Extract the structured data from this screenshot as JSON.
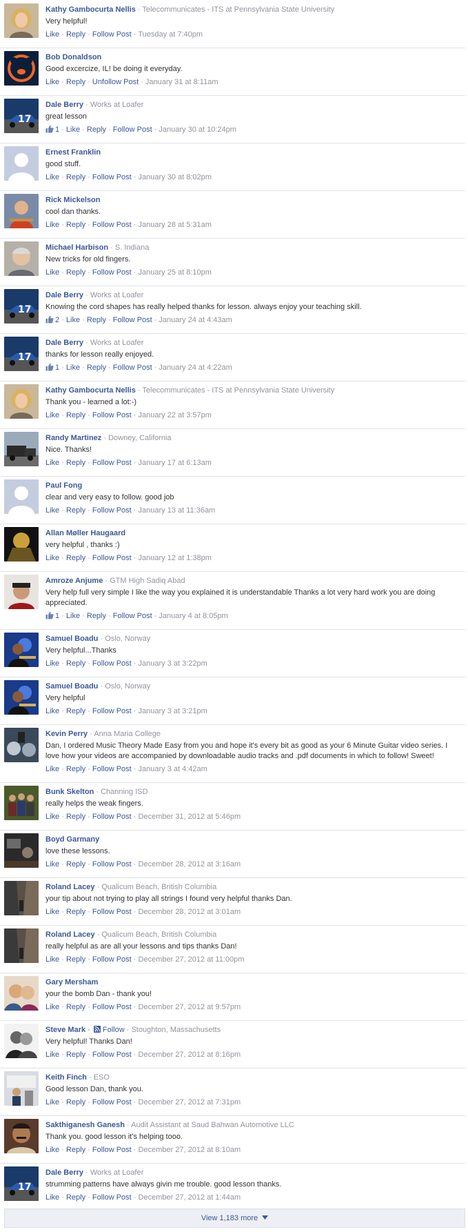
{
  "labels": {
    "like": "Like",
    "reply": "Reply",
    "follow_post": "Follow Post",
    "unfollow_post": "Unfollow Post",
    "follow": "Follow",
    "dot": " · "
  },
  "comments": [
    {
      "author": "Kathy Gambocurta Nellis",
      "subtitle": "Telecommunicates - ITS at Pennsylvania State University",
      "text": "Very helpful!",
      "likes": "",
      "follow": "Follow Post",
      "time": "Tuesday at 7:40pm",
      "avatar": "woman-blonde"
    },
    {
      "author": "Bob Donaldson",
      "subtitle": "",
      "text": "Good excercize, IL! be doing it everyday.",
      "likes": "",
      "follow": "Unfollow Post",
      "time": "January 31 at 8:11am",
      "avatar": "bears-logo"
    },
    {
      "author": "Dale Berry",
      "subtitle": "Works at Loafer",
      "text": "great lesson",
      "likes": "1",
      "follow": "Follow Post",
      "time": "January 30 at 10:24pm",
      "avatar": "race-car"
    },
    {
      "author": "Ernest Franklin",
      "subtitle": "",
      "text": "good stuff.",
      "likes": "",
      "follow": "Follow Post",
      "time": "January 30 at 8:02pm",
      "avatar": "default"
    },
    {
      "author": "Rick Mickelson",
      "subtitle": "",
      "text": "cool dan thanks.",
      "likes": "",
      "follow": "Follow Post",
      "time": "January 28 at 5:31am",
      "avatar": "man-guitar"
    },
    {
      "author": "Michael Harbison",
      "subtitle": "S. Indiana",
      "text": "New tricks for old fingers.",
      "likes": "",
      "follow": "Follow Post",
      "time": "January 25 at 8:10pm",
      "avatar": "man-gray"
    },
    {
      "author": "Dale Berry",
      "subtitle": "Works at Loafer",
      "text": "Knowing the cord shapes has really helped thanks for lesson. always enjoy your teaching skill.",
      "likes": "2",
      "follow": "Follow Post",
      "time": "January 24 at 4:43am",
      "avatar": "race-car"
    },
    {
      "author": "Dale Berry",
      "subtitle": "Works at Loafer",
      "text": "thanks for lesson really enjoyed.",
      "likes": "1",
      "follow": "Follow Post",
      "time": "January 24 at 4:22am",
      "avatar": "race-car"
    },
    {
      "author": "Kathy Gambocurta Nellis",
      "subtitle": "Telecommunicates - ITS at Pennsylvania State University",
      "text": "Thank you - learned a lot:-)",
      "likes": "",
      "follow": "Follow Post",
      "time": "January 22 at 3:57pm",
      "avatar": "woman-blonde"
    },
    {
      "author": "Randy Martinez",
      "subtitle": "Downey, California",
      "text": "Nice. Thanks!",
      "likes": "",
      "follow": "Follow Post",
      "time": "January 17 at 6:13am",
      "avatar": "truck"
    },
    {
      "author": "Paul Fong",
      "subtitle": "",
      "text": "clear and very easy to follow. good job",
      "likes": "",
      "follow": "Follow Post",
      "time": "January 13 at 11:36am",
      "avatar": "default"
    },
    {
      "author": "Allan Møller Haugaard",
      "subtitle": "",
      "text": "very helpful , thanks :)",
      "likes": "",
      "follow": "Follow Post",
      "time": "January 12 at 1:38pm",
      "avatar": "dark-yellow"
    },
    {
      "author": "Amroze Anjume",
      "subtitle": "GTM High Sadiq Abad",
      "text": "Very help full very simple I like the way you explained it is understandable Thanks a lot very hard work you are doing appreciated.",
      "likes": "1",
      "follow": "Follow Post",
      "time": "January 4 at 8:05pm",
      "avatar": "man-cap",
      "tall": true
    },
    {
      "author": "Samuel Boadu",
      "subtitle": "Oslo, Norway",
      "text": "Very helpful...Thanks",
      "likes": "",
      "follow": "Follow Post",
      "time": "January 3 at 3:22pm",
      "avatar": "stage-blue"
    },
    {
      "author": "Samuel Boadu",
      "subtitle": "Oslo, Norway",
      "text": "Very helpful",
      "likes": "",
      "follow": "Follow Post",
      "time": "January 3 at 3:21pm",
      "avatar": "stage-blue"
    },
    {
      "author": "Kevin Perry",
      "subtitle": "Anna Maria College",
      "text": "Dan, I ordered Music Theory Made Easy from you and hope it's every bit as good as your 6 Minute Guitar video series. I love how your videos are accompanied by downloadable audio tracks and .pdf documents in which to follow! Sweet!",
      "likes": "",
      "follow": "Follow Post",
      "time": "January 3 at 4:42am",
      "avatar": "drums",
      "tall": true
    },
    {
      "author": "Bunk Skelton",
      "subtitle": "Channing ISD",
      "text": "really helps the weak fingers.",
      "likes": "",
      "follow": "Follow Post",
      "time": "December 31, 2012 at 5:46pm",
      "avatar": "band"
    },
    {
      "author": "Boyd Garmany",
      "subtitle": "",
      "text": "love these lessons.",
      "likes": "",
      "follow": "Follow Post",
      "time": "December 28, 2012 at 3:16am",
      "avatar": "dark-room"
    },
    {
      "author": "Roland Lacey",
      "subtitle": "Qualicum Beach, British Columbia",
      "text": "your tip about not trying to play all strings I found very helpful thanks Dan.",
      "likes": "",
      "follow": "Follow Post",
      "time": "December 28, 2012 at 3:01am",
      "avatar": "street"
    },
    {
      "author": "Roland Lacey",
      "subtitle": "Qualicum Beach, British Columbia",
      "text": "really helpful as are all your lessons and tips thanks Dan!",
      "likes": "",
      "follow": "Follow Post",
      "time": "December 27, 2012 at 11:00pm",
      "avatar": "street"
    },
    {
      "author": "Gary Mersham",
      "subtitle": "",
      "text": "your the bomb Dan - thank you!",
      "likes": "",
      "follow": "Follow Post",
      "time": "December 27, 2012 at 9:57pm",
      "avatar": "couple"
    },
    {
      "author": "Steve Mark",
      "subtitle": "Stoughton, Massachusetts",
      "text": "Very helpful! Thanks Dan!",
      "likes": "",
      "follow": "Follow Post",
      "time": "December 27, 2012 at 8:16pm",
      "avatar": "bw-couple",
      "inline_follow": true
    },
    {
      "author": "Keith Finch",
      "subtitle": "ESO",
      "text": "Good lesson Dan, thank you.",
      "likes": "",
      "follow": "Follow Post",
      "time": "December 27, 2012 at 7:31pm",
      "avatar": "office"
    },
    {
      "author": "Sakthiganesh Ganesh",
      "subtitle": "Audit Assistant at Saud Bahwan Automotive LLC",
      "text": "Thank you. good lesson it's helping tooo.",
      "likes": "",
      "follow": "Follow Post",
      "time": "December 27, 2012 at 8:10am",
      "avatar": "man-mustache"
    },
    {
      "author": "Dale Berry",
      "subtitle": "Works at Loafer",
      "text": "strumming patterns have always givin me trouble. good lesson thanks.",
      "likes": "",
      "follow": "Follow Post",
      "time": "December 27, 2012 at 1:44am",
      "avatar": "race-car"
    }
  ],
  "view_more": {
    "label": "View 1,183 more"
  },
  "colors": {
    "link": "#3b5998",
    "meta": "#90949c",
    "text": "#333333",
    "divider": "#e1e2e6",
    "view_more_bg": "#edeff4"
  }
}
